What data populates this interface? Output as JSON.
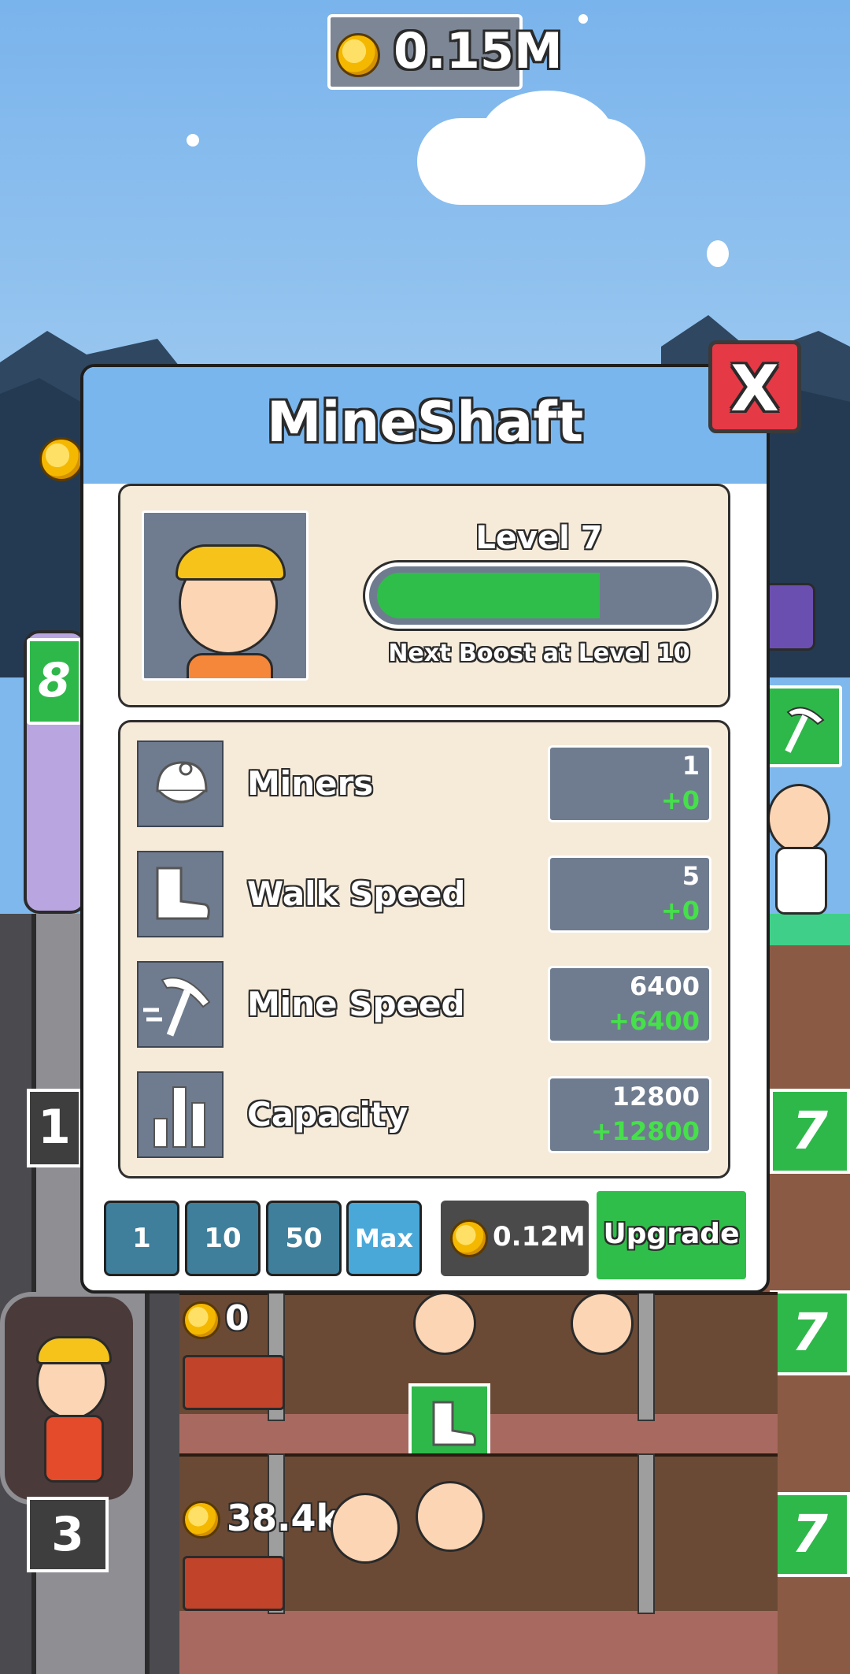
{
  "hud": {
    "coin_total": "0.15M"
  },
  "background": {
    "left_badges": [
      "8",
      "1",
      "3"
    ],
    "right_badges": [
      "7",
      "7",
      "7"
    ],
    "shaft_coins": [
      "0",
      "38.4k"
    ]
  },
  "panel": {
    "title": "MineShaft",
    "close_label": "X",
    "level_label": "Level 7",
    "progress_fraction": 0.68,
    "next_boost": "Next Boost at Level 10",
    "stats": [
      {
        "label": "Miners",
        "value": "1",
        "increase": "+0",
        "icon": "miner-helmet-icon"
      },
      {
        "label": "Walk Speed",
        "value": "5",
        "increase": "+0",
        "icon": "boot-icon"
      },
      {
        "label": "Mine Speed",
        "value": "6400",
        "increase": "+6400",
        "icon": "pickaxe-icon"
      },
      {
        "label": "Capacity",
        "value": "12800",
        "increase": "+12800",
        "icon": "bar-chart-icon"
      }
    ],
    "quantity_options": [
      "1",
      "10",
      "50",
      "Max"
    ],
    "selected_quantity": "Max",
    "cost": "0.12M",
    "upgrade_label": "Upgrade"
  },
  "colors": {
    "sky": "#7fb8ec",
    "panel_header": "#7ab6ee",
    "accent_green": "#2fb84a",
    "close_red": "#e63946",
    "stat_box": "#6f7c8f"
  }
}
